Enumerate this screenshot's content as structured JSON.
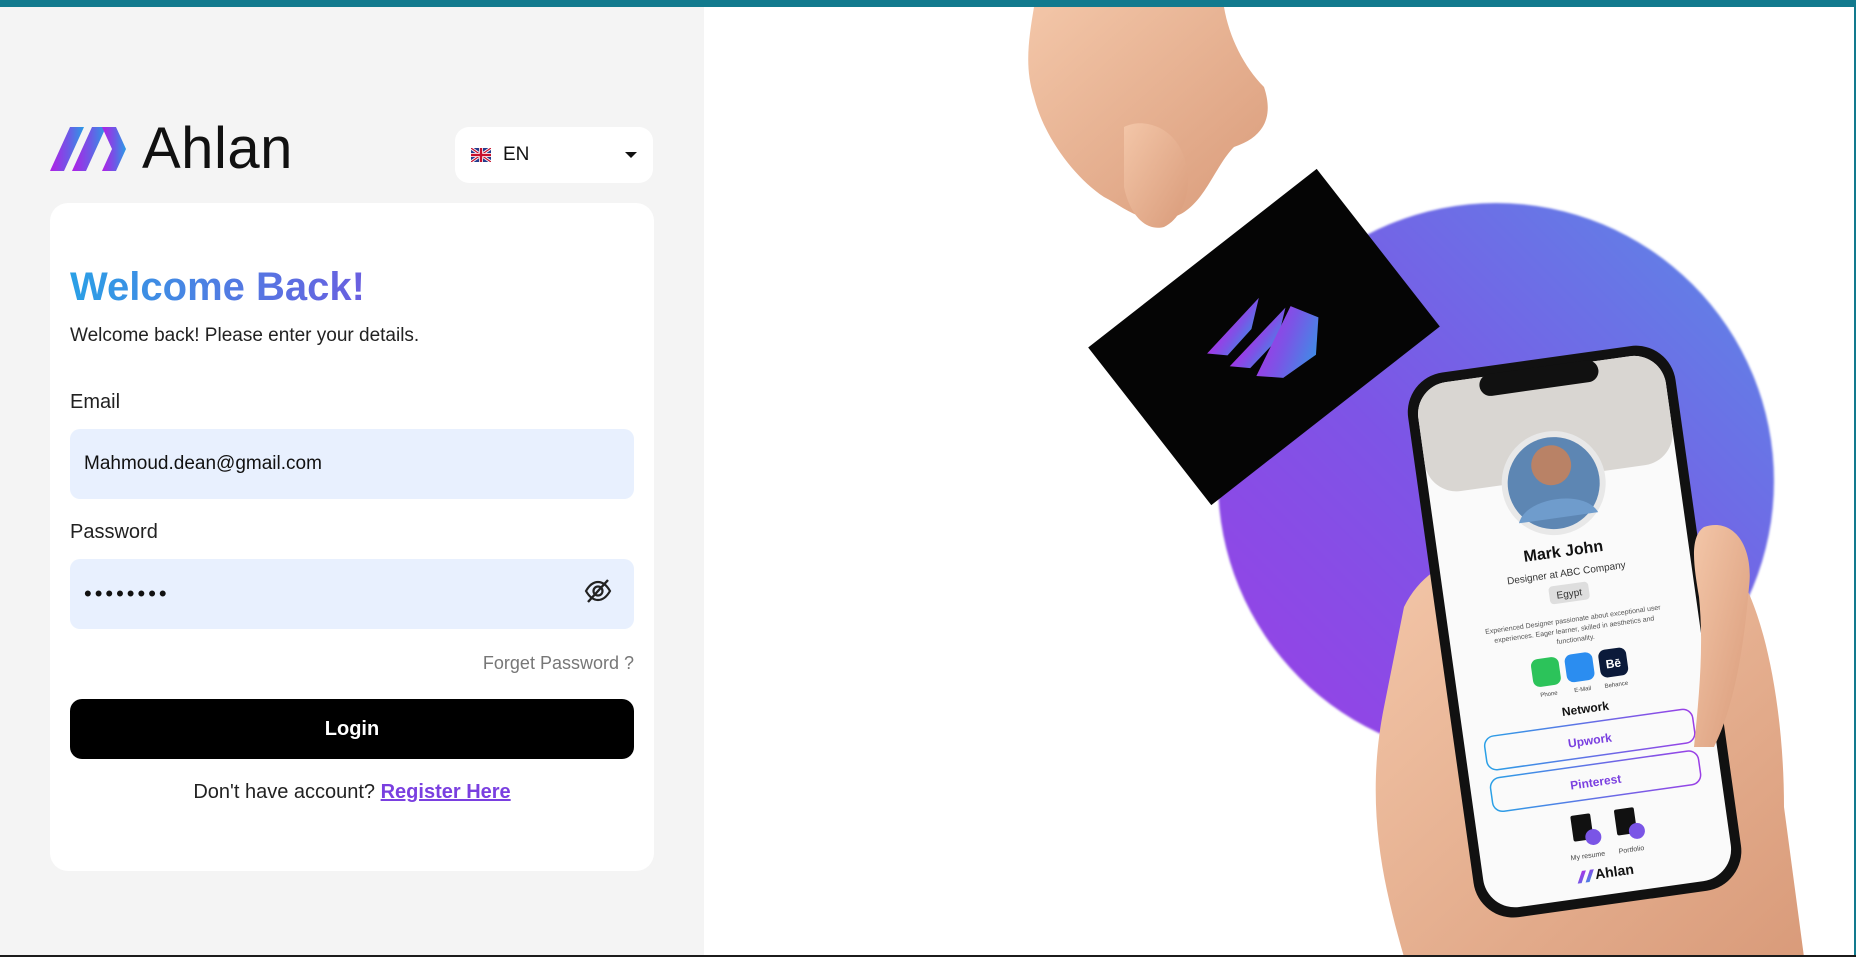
{
  "brand": {
    "name": "Ahlan"
  },
  "language": {
    "code": "EN",
    "flag": "uk-flag-icon"
  },
  "login": {
    "title": "Welcome Back!",
    "subtitle": "Welcome back! Please enter your details.",
    "email_label": "Email",
    "email_value": "Mahmoud.dean@gmail.com",
    "password_label": "Password",
    "password_value": "••••••••",
    "forgot": "Forget Password ?",
    "login_button": "Login",
    "no_account": "Don't have account?",
    "register_link": "Register Here"
  },
  "profile_preview": {
    "name": "Mark John",
    "role": "Designer at ABC Company",
    "country": "Egypt",
    "bio": "Experienced Designer passionate about exceptional user experiences. Eager learner, skilled in aesthetics and functionality.",
    "contacts": [
      "Phone",
      "E-Mail",
      "Behance"
    ],
    "network_title": "Network",
    "network_links": [
      "Upwork",
      "Pinterest"
    ],
    "files": [
      "My resume",
      "Portfolio"
    ],
    "brand": "Ahlan"
  },
  "colors": {
    "accent_teal": "#127a8e",
    "title_gradient_start": "#2aa0e6",
    "title_gradient_end": "#6a5fe0",
    "link_purple": "#7a3fe0",
    "input_bg": "#e8f0fe"
  }
}
